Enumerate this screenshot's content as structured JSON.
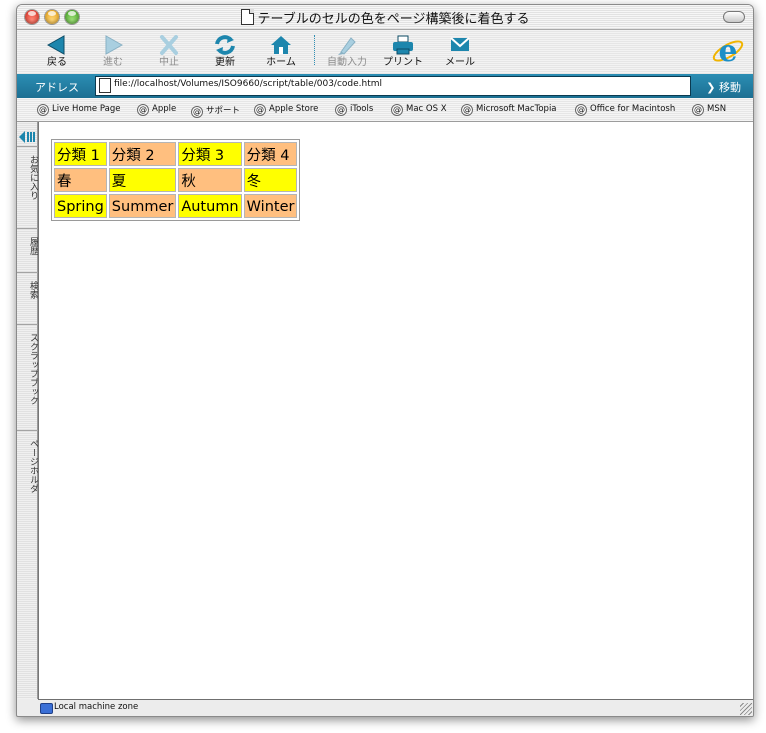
{
  "window": {
    "title": "テーブルのセルの色をページ構築後に着色する"
  },
  "toolbar": {
    "back": "戻る",
    "forward": "進む",
    "stop": "中止",
    "refresh": "更新",
    "home": "ホーム",
    "autofill": "自動入力",
    "print": "プリント",
    "mail": "メール"
  },
  "address": {
    "label": "アドレス",
    "url": "file://localhost/Volumes/ISO9660/script/table/003/code.html",
    "go": "移動"
  },
  "favorites": [
    "Live Home Page",
    "Apple",
    "サポート",
    "Apple Store",
    "iTools",
    "Mac OS X",
    "Microsoft MacTopia",
    "Office for Macintosh",
    "MSN"
  ],
  "sidebar_tabs": [
    "お気に入り",
    "履歴",
    "検索",
    "スクラップブック",
    "ページホルダ"
  ],
  "table": {
    "rows": [
      [
        "分類 1",
        "分類 2",
        "分類 3",
        "分類 4"
      ],
      [
        "春",
        "夏",
        "秋",
        "冬"
      ],
      [
        "Spring",
        "Summer",
        "Autumn",
        "Winter"
      ]
    ],
    "colors": {
      "yellow": "#ffff00",
      "tan": "#ffbf7f"
    }
  },
  "status": {
    "zone": "Local machine zone"
  }
}
